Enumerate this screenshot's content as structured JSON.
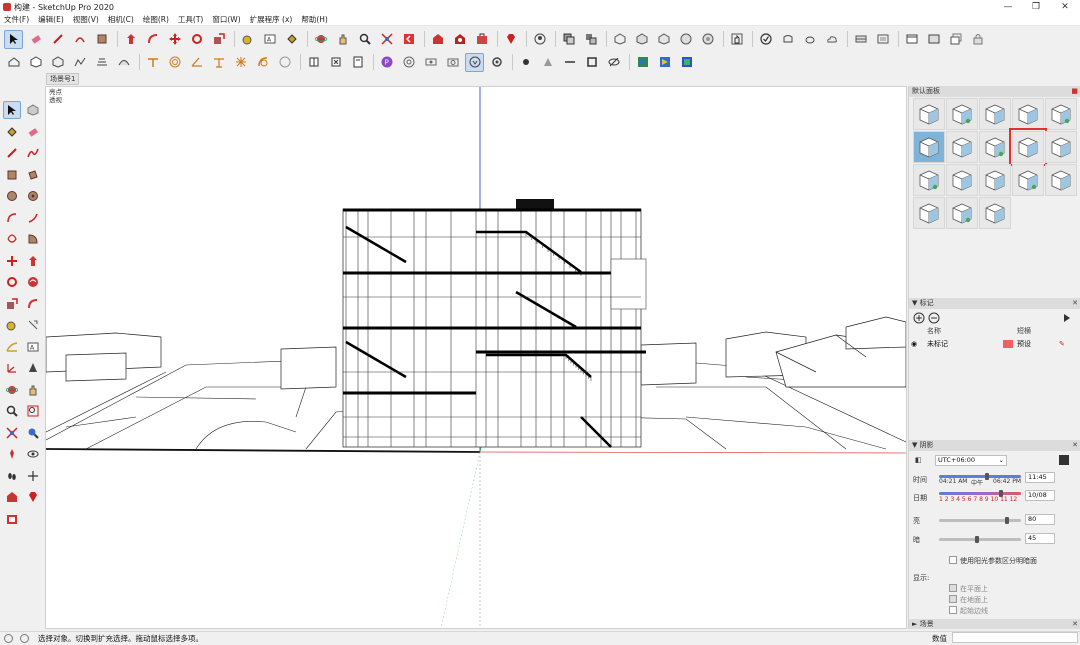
{
  "window": {
    "title": "构建 - SketchUp Pro 2020",
    "minimize": "—",
    "maximize": "❐",
    "close": "✕"
  },
  "menu": [
    "文件(F)",
    "编辑(E)",
    "视图(V)",
    "相机(C)",
    "绘图(R)",
    "工具(T)",
    "窗口(W)",
    "扩展程序 (x)",
    "帮助(H)"
  ],
  "scene_tab": "场景号1",
  "viewport_labels": {
    "line1": "亮点",
    "line2": "透视"
  },
  "tray": {
    "styles_title": "默认面板",
    "styles_count": 18,
    "selected_style_index": 8,
    "tags": {
      "title": "标记",
      "col_name": "名称",
      "col_dash": "短横",
      "row_name": "未标记",
      "row_dash": "预设",
      "row_color": "#f06060"
    },
    "shadows": {
      "title": "阴影",
      "utc": "UTC+06:00",
      "time_label": "时间",
      "time_start": "04:21 AM",
      "time_mid": "中午",
      "time_end": "06:42 PM",
      "time_value": "11:45",
      "date_label": "日期",
      "months": "1 2 3 4 5 6 7 8 9 10 11 12",
      "date_value": "10/08",
      "light_label": "亮",
      "light_value": "80",
      "dark_label": "暗",
      "dark_value": "45",
      "use_sun_label": "使用阳光参数区分明暗面",
      "display_label": "显示:",
      "on_faces": "在平面上",
      "on_ground": "在地面上",
      "from_edges": "起始边线"
    },
    "scenes_title": "场景"
  },
  "status": {
    "message": "选择对象。切换到扩充选择。拖动鼠标选择多项。",
    "measure_label": "数值"
  }
}
